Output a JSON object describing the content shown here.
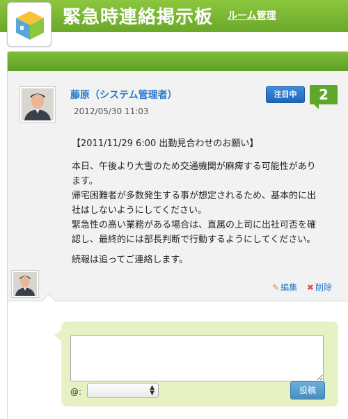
{
  "header": {
    "title": "緊急時連絡掲示板",
    "room_manage_label": "ルーム管理"
  },
  "post": {
    "author": "藤原（システム管理者）",
    "date": "2012/05/30 11:03",
    "attention_badge": "注目中",
    "count": "2",
    "subject": "【2011/11/29 6:00 出勤見合わせのお願い】",
    "paragraph1_line1": "本日、午後より大雪のため交通機関が麻痺する可能性があり",
    "paragraph1_line2": "ます。",
    "paragraph1_line3": "帰宅困難者が多数発生する事が想定されるため、基本的に出",
    "paragraph1_line4": "社はしないようにしてください。",
    "paragraph1_line5": "緊急性の高い業務がある場合は、直属の上司に出社可否を確",
    "paragraph1_line6": "認し、最終的には部長判断で行動するようにしてください。",
    "paragraph2": "続報は追ってご連絡します。",
    "edit_label": "編集",
    "delete_label": "削除"
  },
  "comment": {
    "text_value": "",
    "mention_label": "@:",
    "mention_selected": "",
    "submit_label": "投稿"
  },
  "colors": {
    "header_green": "#6aa82a",
    "link_blue": "#2a78c8",
    "badge_blue": "#1f66b8",
    "count_green": "#5ea72a",
    "comment_bg": "#e7f2c4"
  },
  "icons": {
    "logo": "cube-logo-icon",
    "edit": "pencil-icon",
    "delete": "x-icon"
  }
}
